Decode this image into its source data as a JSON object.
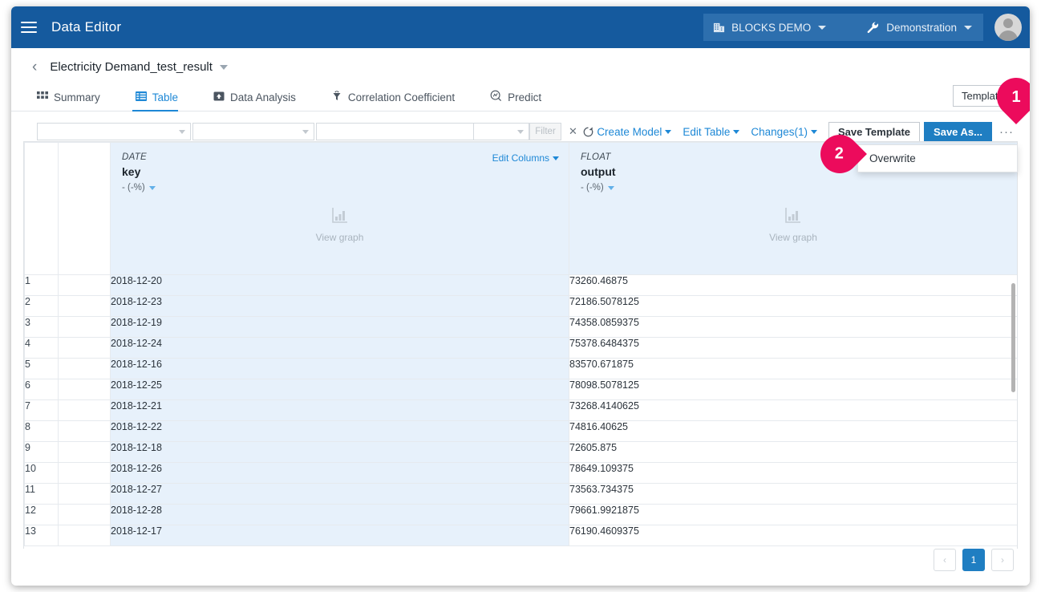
{
  "appbar": {
    "menu_icon": "hamburger-icon",
    "title": "Data Editor",
    "org_chip": {
      "icon": "building-icon",
      "label": "BLOCKS DEMO"
    },
    "env_chip": {
      "icon": "wrench-icon",
      "label": "Demonstration"
    },
    "avatar": "user-avatar"
  },
  "page": {
    "back_icon": "chevron-left-icon",
    "title": "Electricity Demand_test_result"
  },
  "tabs": [
    {
      "label": "Summary",
      "icon": "grid-icon",
      "active": false
    },
    {
      "label": "Table",
      "icon": "table-icon",
      "active": true
    },
    {
      "label": "Data Analysis",
      "icon": "analysis-icon",
      "active": false
    },
    {
      "label": "Correlation Coefficient",
      "icon": "correlation-icon",
      "active": false
    },
    {
      "label": "Predict",
      "icon": "predict-icon",
      "active": false
    }
  ],
  "toolbar": {
    "filter_column_value": "",
    "filter_operator_value": "",
    "filter_text_value": "",
    "filter_mode_value": "",
    "filter_button": "Filter",
    "clear_icon": "close-icon",
    "refresh_icon": "refresh-icon",
    "create_model": "Create Model",
    "edit_table": "Edit Table",
    "changes": "Changes(1)",
    "save_template": "Save Template",
    "save_as": "Save As...",
    "kebab": "···",
    "template_ghost": "Template"
  },
  "menu": {
    "items": [
      {
        "label": "Overwrite"
      }
    ]
  },
  "table": {
    "edit_columns": "Edit Columns",
    "view_graph": "View graph",
    "columns": [
      {
        "type": "DATE",
        "name": "key",
        "stat": "- (-%)"
      },
      {
        "type": "FLOAT",
        "name": "output",
        "stat": "- (-%)"
      }
    ],
    "rows": [
      {
        "num": "1",
        "key": "2018-12-20",
        "output": "73260.46875"
      },
      {
        "num": "2",
        "key": "2018-12-23",
        "output": "72186.5078125"
      },
      {
        "num": "3",
        "key": "2018-12-19",
        "output": "74358.0859375"
      },
      {
        "num": "4",
        "key": "2018-12-24",
        "output": "75378.6484375"
      },
      {
        "num": "5",
        "key": "2018-12-16",
        "output": "83570.671875"
      },
      {
        "num": "6",
        "key": "2018-12-25",
        "output": "78098.5078125"
      },
      {
        "num": "7",
        "key": "2018-12-21",
        "output": "73268.4140625"
      },
      {
        "num": "8",
        "key": "2018-12-22",
        "output": "74816.40625"
      },
      {
        "num": "9",
        "key": "2018-12-18",
        "output": "72605.875"
      },
      {
        "num": "10",
        "key": "2018-12-26",
        "output": "78649.109375"
      },
      {
        "num": "11",
        "key": "2018-12-27",
        "output": "73563.734375"
      },
      {
        "num": "12",
        "key": "2018-12-28",
        "output": "79661.9921875"
      },
      {
        "num": "13",
        "key": "2018-12-17",
        "output": "76190.4609375"
      }
    ]
  },
  "pagination": {
    "prev": "‹",
    "current": "1",
    "next": "›"
  },
  "annotations": [
    {
      "id": "1",
      "label": "1",
      "points_to": "kebab-menu-button"
    },
    {
      "id": "2",
      "label": "2",
      "points_to": "menu-item-overwrite"
    }
  ],
  "colors": {
    "appbar": "#155a9e",
    "accent": "#1e88d6",
    "primary_button": "#1f7ec2",
    "annotation": "#ec0b5c",
    "key_column_highlight": "#e7f1fb"
  }
}
